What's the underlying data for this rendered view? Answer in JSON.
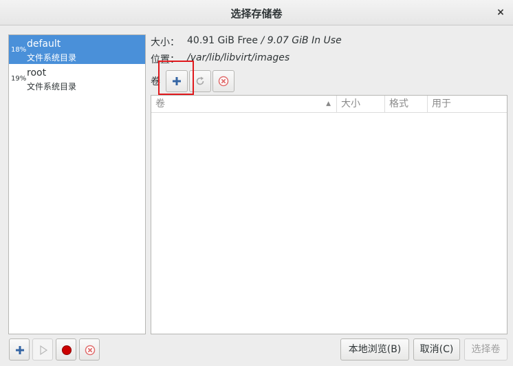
{
  "window": {
    "title": "选择存储卷",
    "close_label": "×"
  },
  "pools": [
    {
      "name": "default",
      "usage": "18%",
      "type": "文件系统目录",
      "selected": true
    },
    {
      "name": "root",
      "usage": "19%",
      "type": "文件系统目录",
      "selected": false
    }
  ],
  "details": {
    "size_label": "大小：",
    "size_free": "40.91 GiB Free",
    "size_sep": " / ",
    "size_used": "9.07 GiB In Use",
    "location_label": "位置：",
    "location_value": "/var/lib/libvirt/images",
    "volumes_label": "卷"
  },
  "table": {
    "columns": [
      "卷",
      "大小",
      "格式",
      "用于"
    ],
    "sort_indicator": "▲",
    "rows": []
  },
  "buttons": {
    "browse_local": "本地浏览(B)",
    "cancel": "取消(C)",
    "choose_volume": "选择卷"
  },
  "colors": {
    "selection": "#4a90d9",
    "highlight_box": "#e0171b",
    "add_icon": "#3465a4",
    "record_icon": "#cc0000",
    "delete_icon": "#e06c6c"
  }
}
